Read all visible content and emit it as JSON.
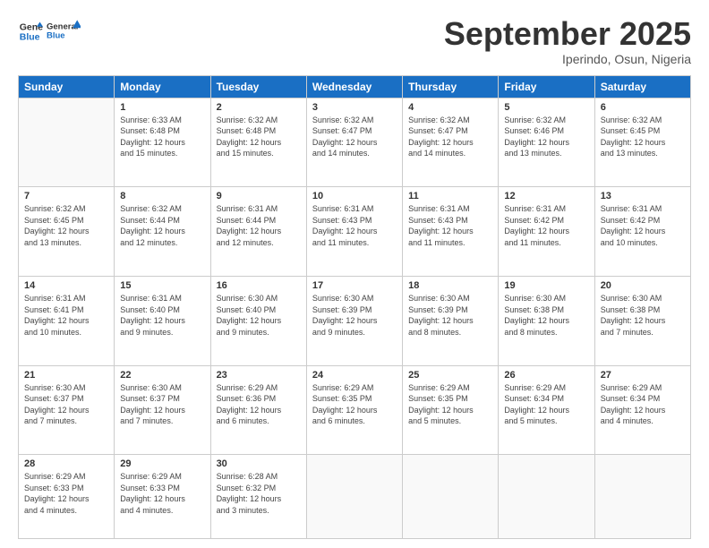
{
  "logo": {
    "line1": "General",
    "line2": "Blue"
  },
  "header": {
    "month": "September 2025",
    "location": "Iperindo, Osun, Nigeria"
  },
  "days_of_week": [
    "Sunday",
    "Monday",
    "Tuesday",
    "Wednesday",
    "Thursday",
    "Friday",
    "Saturday"
  ],
  "weeks": [
    [
      {
        "num": "",
        "info": ""
      },
      {
        "num": "1",
        "info": "Sunrise: 6:33 AM\nSunset: 6:48 PM\nDaylight: 12 hours\nand 15 minutes."
      },
      {
        "num": "2",
        "info": "Sunrise: 6:32 AM\nSunset: 6:48 PM\nDaylight: 12 hours\nand 15 minutes."
      },
      {
        "num": "3",
        "info": "Sunrise: 6:32 AM\nSunset: 6:47 PM\nDaylight: 12 hours\nand 14 minutes."
      },
      {
        "num": "4",
        "info": "Sunrise: 6:32 AM\nSunset: 6:47 PM\nDaylight: 12 hours\nand 14 minutes."
      },
      {
        "num": "5",
        "info": "Sunrise: 6:32 AM\nSunset: 6:46 PM\nDaylight: 12 hours\nand 13 minutes."
      },
      {
        "num": "6",
        "info": "Sunrise: 6:32 AM\nSunset: 6:45 PM\nDaylight: 12 hours\nand 13 minutes."
      }
    ],
    [
      {
        "num": "7",
        "info": "Sunrise: 6:32 AM\nSunset: 6:45 PM\nDaylight: 12 hours\nand 13 minutes."
      },
      {
        "num": "8",
        "info": "Sunrise: 6:32 AM\nSunset: 6:44 PM\nDaylight: 12 hours\nand 12 minutes."
      },
      {
        "num": "9",
        "info": "Sunrise: 6:31 AM\nSunset: 6:44 PM\nDaylight: 12 hours\nand 12 minutes."
      },
      {
        "num": "10",
        "info": "Sunrise: 6:31 AM\nSunset: 6:43 PM\nDaylight: 12 hours\nand 11 minutes."
      },
      {
        "num": "11",
        "info": "Sunrise: 6:31 AM\nSunset: 6:43 PM\nDaylight: 12 hours\nand 11 minutes."
      },
      {
        "num": "12",
        "info": "Sunrise: 6:31 AM\nSunset: 6:42 PM\nDaylight: 12 hours\nand 11 minutes."
      },
      {
        "num": "13",
        "info": "Sunrise: 6:31 AM\nSunset: 6:42 PM\nDaylight: 12 hours\nand 10 minutes."
      }
    ],
    [
      {
        "num": "14",
        "info": "Sunrise: 6:31 AM\nSunset: 6:41 PM\nDaylight: 12 hours\nand 10 minutes."
      },
      {
        "num": "15",
        "info": "Sunrise: 6:31 AM\nSunset: 6:40 PM\nDaylight: 12 hours\nand 9 minutes."
      },
      {
        "num": "16",
        "info": "Sunrise: 6:30 AM\nSunset: 6:40 PM\nDaylight: 12 hours\nand 9 minutes."
      },
      {
        "num": "17",
        "info": "Sunrise: 6:30 AM\nSunset: 6:39 PM\nDaylight: 12 hours\nand 9 minutes."
      },
      {
        "num": "18",
        "info": "Sunrise: 6:30 AM\nSunset: 6:39 PM\nDaylight: 12 hours\nand 8 minutes."
      },
      {
        "num": "19",
        "info": "Sunrise: 6:30 AM\nSunset: 6:38 PM\nDaylight: 12 hours\nand 8 minutes."
      },
      {
        "num": "20",
        "info": "Sunrise: 6:30 AM\nSunset: 6:38 PM\nDaylight: 12 hours\nand 7 minutes."
      }
    ],
    [
      {
        "num": "21",
        "info": "Sunrise: 6:30 AM\nSunset: 6:37 PM\nDaylight: 12 hours\nand 7 minutes."
      },
      {
        "num": "22",
        "info": "Sunrise: 6:30 AM\nSunset: 6:37 PM\nDaylight: 12 hours\nand 7 minutes."
      },
      {
        "num": "23",
        "info": "Sunrise: 6:29 AM\nSunset: 6:36 PM\nDaylight: 12 hours\nand 6 minutes."
      },
      {
        "num": "24",
        "info": "Sunrise: 6:29 AM\nSunset: 6:35 PM\nDaylight: 12 hours\nand 6 minutes."
      },
      {
        "num": "25",
        "info": "Sunrise: 6:29 AM\nSunset: 6:35 PM\nDaylight: 12 hours\nand 5 minutes."
      },
      {
        "num": "26",
        "info": "Sunrise: 6:29 AM\nSunset: 6:34 PM\nDaylight: 12 hours\nand 5 minutes."
      },
      {
        "num": "27",
        "info": "Sunrise: 6:29 AM\nSunset: 6:34 PM\nDaylight: 12 hours\nand 4 minutes."
      }
    ],
    [
      {
        "num": "28",
        "info": "Sunrise: 6:29 AM\nSunset: 6:33 PM\nDaylight: 12 hours\nand 4 minutes."
      },
      {
        "num": "29",
        "info": "Sunrise: 6:29 AM\nSunset: 6:33 PM\nDaylight: 12 hours\nand 4 minutes."
      },
      {
        "num": "30",
        "info": "Sunrise: 6:28 AM\nSunset: 6:32 PM\nDaylight: 12 hours\nand 3 minutes."
      },
      {
        "num": "",
        "info": ""
      },
      {
        "num": "",
        "info": ""
      },
      {
        "num": "",
        "info": ""
      },
      {
        "num": "",
        "info": ""
      }
    ]
  ]
}
